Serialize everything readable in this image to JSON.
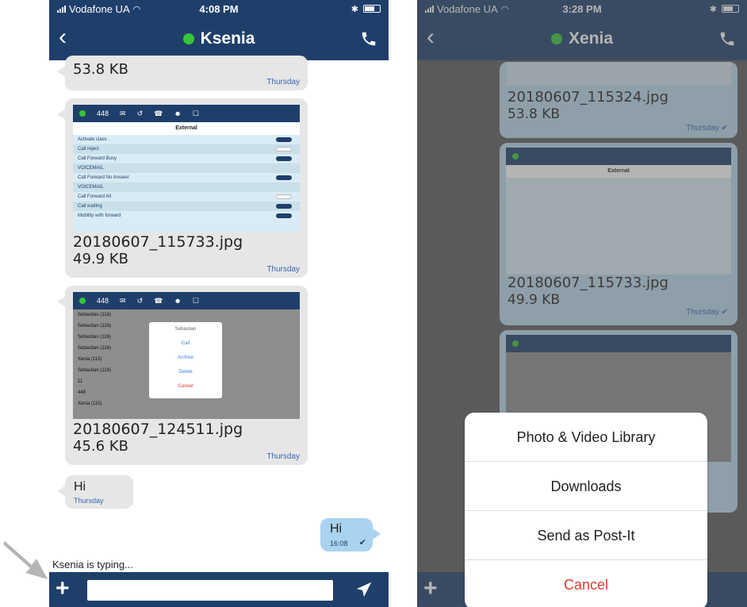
{
  "left": {
    "status": {
      "carrier": "Vodafone UA",
      "time": "4:08 PM"
    },
    "header": {
      "title": "Ksenia"
    },
    "messages": [
      {
        "size": "53.8 KB",
        "stamp": "Thursday"
      },
      {
        "name": "20180607_115733.jpg",
        "size": "49.9 KB",
        "stamp": "Thursday",
        "preview": {
          "count": "448",
          "title": "External",
          "rows": [
            "Activate class",
            "Call reject",
            "Call Forward Busy",
            "VOICEMAIL",
            "Call Forward No Answer",
            "VOICEMAIL",
            "Call Forward All",
            "Call waiting",
            "Mobility with forward"
          ]
        }
      },
      {
        "name": "20180607_124511.jpg",
        "size": "45.6 KB",
        "stamp": "Thursday",
        "preview": {
          "count": "448",
          "rows": [
            "Sebastian (116)",
            "Sebastian (116)",
            "Sebastian (116)",
            "Sebastian (116)",
            "Xenia (115)",
            "Sebastian (116)",
            "11",
            "448",
            "Xenia (115)"
          ],
          "popup": [
            "Sebastian",
            "Call",
            "Archive",
            "Delete",
            "Cancel"
          ]
        }
      },
      {
        "text": "Hi",
        "stamp": "Thursday"
      }
    ],
    "outgoing": {
      "text": "Hi",
      "time": "16:08",
      "check": "✔"
    },
    "typing": "Ksenia is typing...",
    "composer": {
      "plus": "+",
      "placeholder": ""
    }
  },
  "right": {
    "status": {
      "carrier": "Vodafone UA",
      "time": "3:28 PM"
    },
    "header": {
      "title": "Xenia"
    },
    "messages": [
      {
        "name": "20180607_115324.jpg",
        "size": "53.8 KB",
        "stamp": "Thursday ✔"
      },
      {
        "name": "20180607_115733.jpg",
        "size": "49.9 KB",
        "stamp": "Thursday ✔"
      }
    ],
    "sheet": {
      "items": [
        "Photo & Video Library",
        "Downloads",
        "Send as Post-It"
      ],
      "cancel": "Cancel"
    }
  }
}
